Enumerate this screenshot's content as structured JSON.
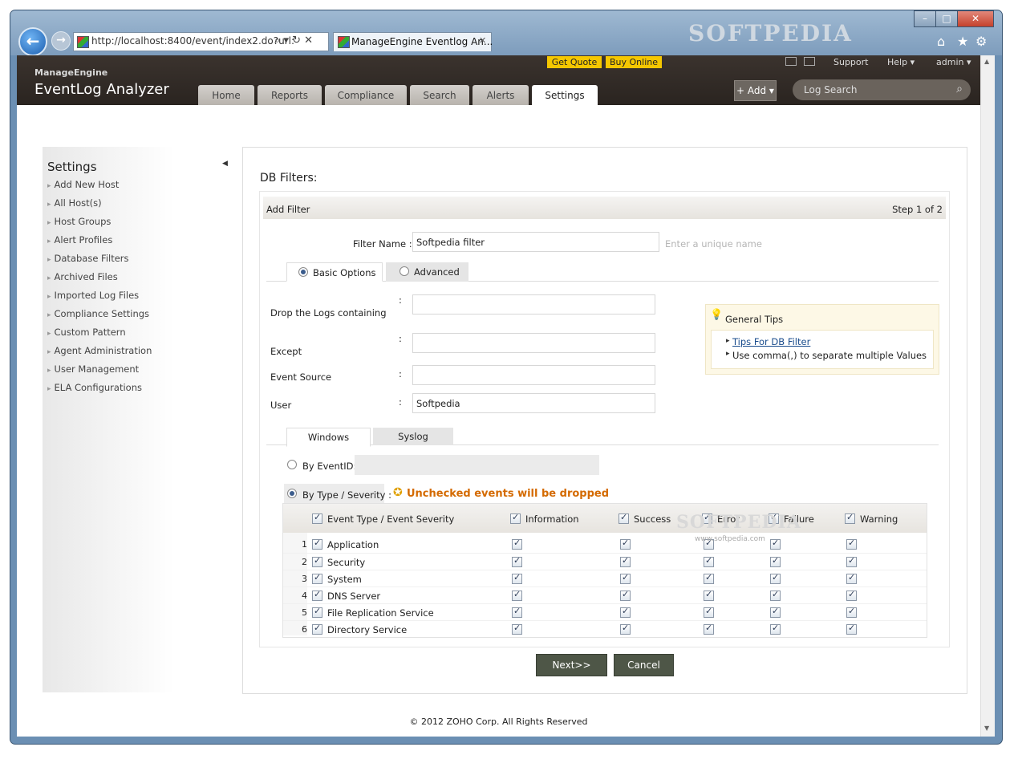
{
  "browser": {
    "url": "http://localhost:8400/event/index2.do?url:",
    "tab_title": "ManageEngine Eventlog An...",
    "watermark": "SOFTPEDIA",
    "back_glyph": "←",
    "forward_glyph": "→",
    "minimize_glyph": "–",
    "maximize_glyph": "□",
    "close_glyph": "✕",
    "home_glyph": "⌂",
    "favorites_glyph": "★",
    "tools_glyph": "⚙",
    "tab_close_glyph": "✕",
    "addr_icons": "⌕ ▾ ↻ ✕"
  },
  "header": {
    "brand_small": "ManageEngine",
    "brand_main": "EventLog Analyzer",
    "get_quote": "Get Quote",
    "buy_online": "Buy Online",
    "support": "Support",
    "help": "Help ▾",
    "admin": "admin ▾",
    "add": "+ Add ▾",
    "log_search_placeholder": "Log Search",
    "search_glyph": "⌕",
    "nav": [
      "Home",
      "Reports",
      "Compliance",
      "Search",
      "Alerts",
      "Settings"
    ],
    "active_nav": "Settings"
  },
  "sidebar": {
    "title": "Settings",
    "collapse_glyph": "◀",
    "items": [
      "Add New Host",
      "All Host(s)",
      "Host Groups",
      "Alert Profiles",
      "Database Filters",
      "Archived Files",
      "Imported Log Files",
      "Compliance Settings",
      "Custom Pattern",
      "Agent Administration",
      "User Management",
      "ELA Configurations"
    ]
  },
  "main": {
    "title": "DB Filters:",
    "bar_title": "Add Filter",
    "step": "Step 1 of 2",
    "filter_name_label": "Filter Name :",
    "filter_name_value": "Softpedia filter",
    "filter_name_hint": "Enter a unique name",
    "basic_options": "Basic Options",
    "advanced": "Advanced",
    "drop_label": "Drop the Logs containing",
    "except_label": "Except",
    "event_source_label": "Event Source",
    "user_label": "User",
    "colon": ":",
    "drop_value": "",
    "except_value": "",
    "event_source_value": "",
    "user_value": "Softpedia",
    "tips_title": "General Tips",
    "tips_link": "Tips For DB Filter",
    "tips_text": "Use comma(,) to separate multiple Values",
    "bullet": "▸",
    "bulb_glyph": "💡",
    "windows_tab": "Windows",
    "syslog_tab": "Syslog",
    "by_eventid": "By EventID:",
    "by_type": "By Type / Severity :",
    "warning_icon": "✪",
    "warning": "Unchecked events will be dropped",
    "columns": [
      "Event Type / Event Severity",
      "Information",
      "Success",
      "Error",
      "Failure",
      "Warning"
    ],
    "rows": [
      {
        "num": "1",
        "name": "Application"
      },
      {
        "num": "2",
        "name": "Security"
      },
      {
        "num": "3",
        "name": "System"
      },
      {
        "num": "4",
        "name": "DNS Server"
      },
      {
        "num": "5",
        "name": "File Replication Service"
      },
      {
        "num": "6",
        "name": "Directory Service"
      }
    ],
    "watermark_big": "SOFTPEDIA",
    "watermark_small": "www.softpedia.com",
    "next": "Next>>",
    "cancel": "Cancel"
  },
  "footer": "© 2012 ZOHO Corp. All Rights Reserved",
  "colors": {
    "accent_yellow": "#f5c700",
    "header_dark": "#2f2925",
    "button_olive": "#4e5647",
    "warning_orange": "#d46a00"
  }
}
